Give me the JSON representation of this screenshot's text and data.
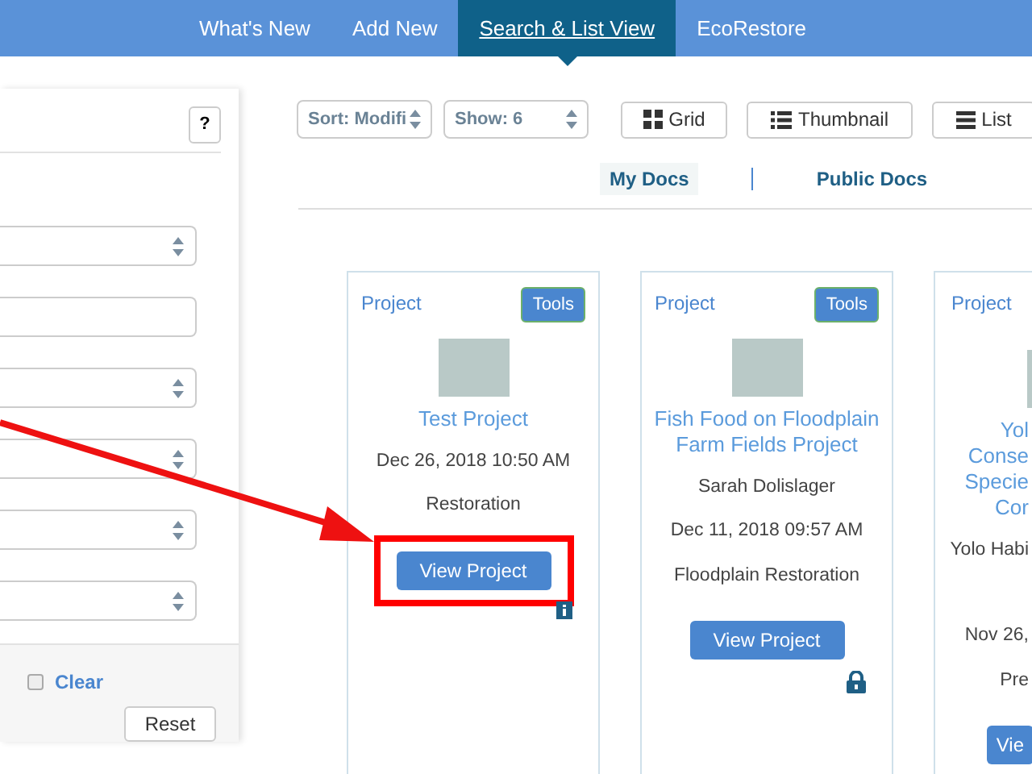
{
  "nav": {
    "tabs": [
      {
        "label": "What's New",
        "selected": false
      },
      {
        "label": "Add New",
        "selected": false
      },
      {
        "label": "Search & List View",
        "selected": true
      },
      {
        "label": "EcoRestore",
        "selected": false
      }
    ]
  },
  "filter_panel": {
    "help_button": "?",
    "fields": [
      {
        "kind": "select"
      },
      {
        "kind": "input"
      },
      {
        "kind": "select"
      },
      {
        "kind": "select"
      },
      {
        "kind": "select"
      },
      {
        "kind": "select"
      }
    ],
    "clear_checkbox": {
      "checked": false
    },
    "clear_link": "Clear",
    "reset_button": "Reset"
  },
  "toolbar": {
    "sort": "Sort: Modifi",
    "show": "Show: 6",
    "views": [
      {
        "kind": "grid",
        "label": "Grid"
      },
      {
        "kind": "thumbnail",
        "label": "Thumbnail"
      },
      {
        "kind": "list",
        "label": "List"
      }
    ]
  },
  "doc_tabs": [
    {
      "label": "My Docs",
      "selected": true
    },
    {
      "label": "Public Docs",
      "selected": false
    }
  ],
  "cards": [
    {
      "type_label": "Project",
      "tools_button": "Tools",
      "title_lines": [
        "Test Project"
      ],
      "lines": [
        "Dec 26, 2018 10:50 AM",
        "Restoration"
      ],
      "button": "View Project",
      "badge": {
        "kind": "info"
      },
      "highlighted": true
    },
    {
      "type_label": "Project",
      "tools_button": "Tools",
      "title_lines": [
        "Fish Food on Floodplain",
        "Farm Fields Project"
      ],
      "lines": [
        "Sarah Dolislager",
        "Dec 11, 2018 09:57 AM",
        "Floodplain Restoration"
      ],
      "button": "View Project",
      "badge": {
        "kind": "lock"
      },
      "highlighted": false
    },
    {
      "kind": "partial",
      "type_label": "Project",
      "title_lines": [
        "Yol",
        "Conse",
        "Specie",
        "Cor"
      ],
      "lines": [
        "Yolo Habi",
        "Nov 26,",
        "Pre"
      ],
      "button": "Vie",
      "highlighted": false
    }
  ]
}
